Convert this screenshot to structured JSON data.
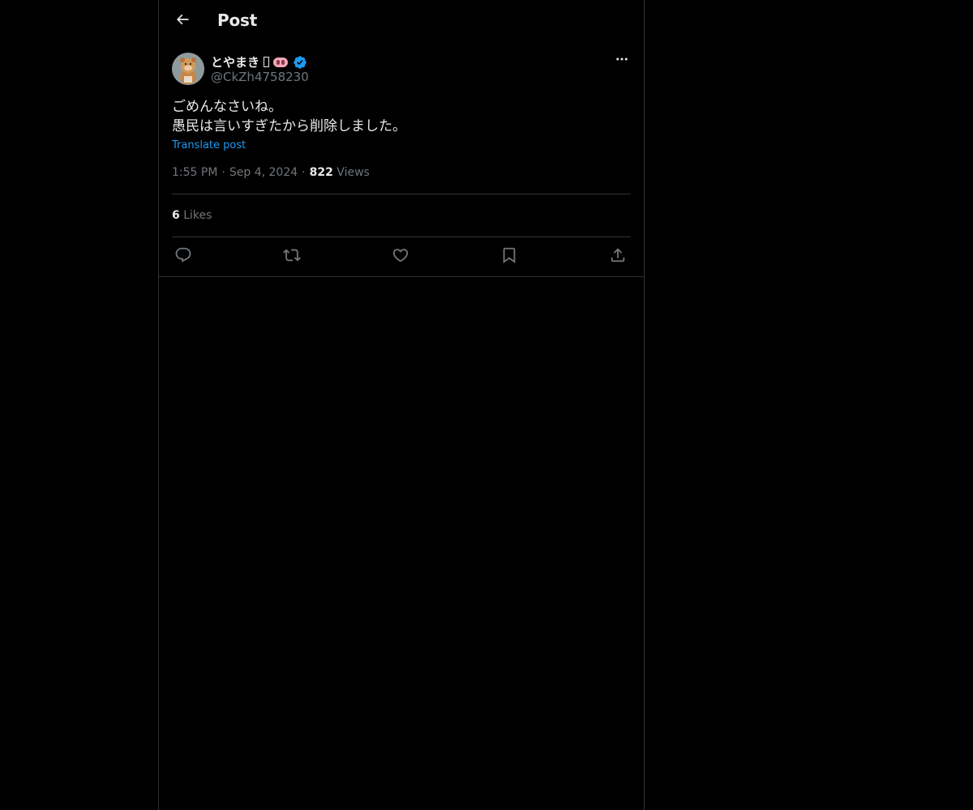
{
  "header": {
    "title": "Post",
    "back_icon": "arrow-left-icon"
  },
  "post": {
    "author": {
      "display_name": "とやまき",
      "emoji": "pig-nose-emoji",
      "verified": true,
      "handle": "@CkZh4758230"
    },
    "text_lines": [
      "ごめんなさいね。",
      "愚民は言いすぎたから削除しました。"
    ],
    "translate_label": "Translate post",
    "time": "1:55 PM",
    "date": "Sep 4, 2024",
    "views_count": "822",
    "views_label": "Views",
    "likes_count": "6",
    "likes_label": "Likes"
  },
  "actions": [
    {
      "name": "reply",
      "icon": "reply-icon"
    },
    {
      "name": "repost",
      "icon": "repost-icon"
    },
    {
      "name": "like",
      "icon": "heart-icon"
    },
    {
      "name": "bookmark",
      "icon": "bookmark-icon"
    },
    {
      "name": "share",
      "icon": "share-icon"
    }
  ],
  "colors": {
    "background": "#000000",
    "text": "#e7e9ea",
    "secondary": "#71767b",
    "accent": "#1d9bf0",
    "border": "#2f3336"
  }
}
